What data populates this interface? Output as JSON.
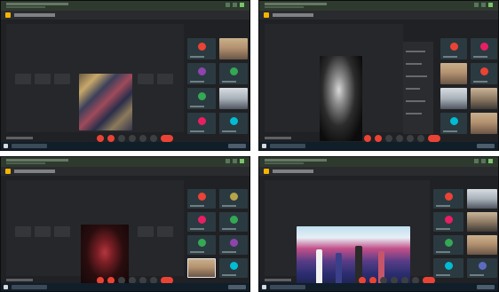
{
  "screens": [
    {
      "window_title": "",
      "meeting_title": "",
      "main_video_desc": "",
      "participants": [
        {
          "label": "",
          "color": "#ea4335"
        },
        {
          "label": "",
          "color": "#8e44ad"
        },
        {
          "label": "",
          "color": "#e91e63"
        },
        {
          "label": "",
          "color": "#34a853"
        },
        {
          "label": "",
          "color": "#00bcd4"
        }
      ]
    },
    {
      "window_title": "",
      "meeting_title": "",
      "main_video_desc": "",
      "participants": [
        {
          "label": "",
          "color": "#ea4335"
        },
        {
          "label": "",
          "color": "#e91e63"
        },
        {
          "label": "",
          "color": "#ea4335"
        },
        {
          "label": "",
          "color": "#00bcd4"
        },
        {
          "label": "",
          "color": "#00bcd4"
        }
      ]
    },
    {
      "window_title": "",
      "meeting_title": "",
      "main_video_desc": "",
      "participants": [
        {
          "label": "",
          "color": "#ea4335"
        },
        {
          "label": "",
          "color": "#e91e63"
        },
        {
          "label": "",
          "color": "#34a853"
        },
        {
          "label": "",
          "color": "#8e44ad"
        },
        {
          "label": "",
          "color": "#00bcd4"
        }
      ]
    },
    {
      "window_title": "",
      "meeting_title": "",
      "main_video_desc": "",
      "participants": [
        {
          "label": "",
          "color": "#ea4335"
        },
        {
          "label": "",
          "color": "#e91e63"
        },
        {
          "label": "",
          "color": "#34a853"
        },
        {
          "label": "",
          "color": "#00bcd4"
        }
      ]
    }
  ],
  "colors": {
    "window_bg": "#202124",
    "titlebar": "#2f3a2e",
    "end_call": "#ea4335",
    "meet_logo": "#f5b400"
  }
}
